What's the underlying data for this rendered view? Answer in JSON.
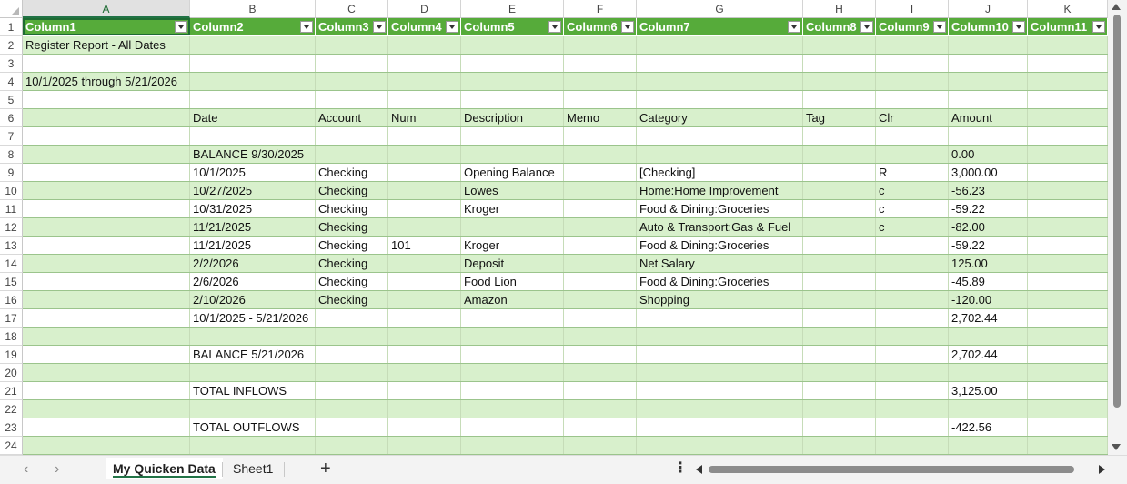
{
  "column_letters": [
    "A",
    "B",
    "C",
    "D",
    "E",
    "F",
    "G",
    "H",
    "I",
    "J",
    "K"
  ],
  "selected_column": "A",
  "row_numbers": [
    "1",
    "2",
    "3",
    "4",
    "5",
    "6",
    "7",
    "8",
    "9",
    "10",
    "11",
    "12",
    "13",
    "14",
    "15",
    "16",
    "17",
    "18",
    "19",
    "20",
    "21",
    "22",
    "23",
    "24"
  ],
  "table_headers": [
    "Column1",
    "Column2",
    "Column3",
    "Column4",
    "Column5",
    "Column6",
    "Column7",
    "Column8",
    "Column9",
    "Column10",
    "Column11"
  ],
  "rows": [
    [
      "Register Report - All Dates",
      "",
      "",
      "",
      "",
      "",
      "",
      "",
      "",
      "",
      ""
    ],
    [
      "",
      "",
      "",
      "",
      "",
      "",
      "",
      "",
      "",
      "",
      ""
    ],
    [
      "10/1/2025 through 5/21/2026",
      "",
      "",
      "",
      "",
      "",
      "",
      "",
      "",
      "",
      ""
    ],
    [
      "",
      "",
      "",
      "",
      "",
      "",
      "",
      "",
      "",
      "",
      ""
    ],
    [
      "",
      "Date",
      "Account",
      "Num",
      "Description",
      "Memo",
      "Category",
      "Tag",
      "Clr",
      "Amount",
      ""
    ],
    [
      "",
      "",
      "",
      "",
      "",
      "",
      "",
      "",
      "",
      "",
      ""
    ],
    [
      "",
      "BALANCE 9/30/2025",
      "",
      "",
      "",
      "",
      "",
      "",
      "",
      "0.00",
      ""
    ],
    [
      "",
      "10/1/2025",
      "Checking",
      "",
      "Opening Balance",
      "",
      "[Checking]",
      "",
      "R",
      "3,000.00",
      ""
    ],
    [
      "",
      "10/27/2025",
      "Checking",
      "",
      "Lowes",
      "",
      "Home:Home Improvement",
      "",
      "c",
      "-56.23",
      ""
    ],
    [
      "",
      "10/31/2025",
      "Checking",
      "",
      "Kroger",
      "",
      "Food & Dining:Groceries",
      "",
      "c",
      "-59.22",
      ""
    ],
    [
      "",
      "11/21/2025",
      "Checking",
      "",
      "",
      "",
      "Auto & Transport:Gas & Fuel",
      "",
      "c",
      "-82.00",
      ""
    ],
    [
      "",
      "11/21/2025",
      "Checking",
      "101",
      "Kroger",
      "",
      "Food & Dining:Groceries",
      "",
      "",
      "-59.22",
      ""
    ],
    [
      "",
      "2/2/2026",
      "Checking",
      "",
      "Deposit",
      "",
      "Net Salary",
      "",
      "",
      "125.00",
      ""
    ],
    [
      "",
      "2/6/2026",
      "Checking",
      "",
      "Food Lion",
      "",
      "Food & Dining:Groceries",
      "",
      "",
      "-45.89",
      ""
    ],
    [
      "",
      "2/10/2026",
      "Checking",
      "",
      "Amazon",
      "",
      "Shopping",
      "",
      "",
      "-120.00",
      ""
    ],
    [
      "",
      "10/1/2025 - 5/21/2026",
      "",
      "",
      "",
      "",
      "",
      "",
      "",
      "2,702.44",
      ""
    ],
    [
      "",
      "",
      "",
      "",
      "",
      "",
      "",
      "",
      "",
      "",
      ""
    ],
    [
      "",
      "BALANCE 5/21/2026",
      "",
      "",
      "",
      "",
      "",
      "",
      "",
      "2,702.44",
      ""
    ],
    [
      "",
      "",
      "",
      "",
      "",
      "",
      "",
      "",
      "",
      "",
      ""
    ],
    [
      "",
      "TOTAL INFLOWS",
      "",
      "",
      "",
      "",
      "",
      "",
      "",
      "3,125.00",
      ""
    ],
    [
      "",
      "",
      "",
      "",
      "",
      "",
      "",
      "",
      "",
      "",
      ""
    ],
    [
      "",
      "TOTAL OUTFLOWS",
      "",
      "",
      "",
      "",
      "",
      "",
      "",
      "-422.56",
      ""
    ],
    [
      "",
      "",
      "",
      "",
      "",
      "",
      "",
      "",
      "",
      "",
      ""
    ]
  ],
  "sheet_tabs": [
    {
      "label": "My Quicken Data",
      "active": true
    },
    {
      "label": "Sheet1",
      "active": false
    }
  ],
  "add_sheet_label": "+",
  "more_label": "⋮",
  "colors": {
    "header_green": "#56ab3a",
    "band_green": "#d8f0cc",
    "accent": "#217346"
  }
}
